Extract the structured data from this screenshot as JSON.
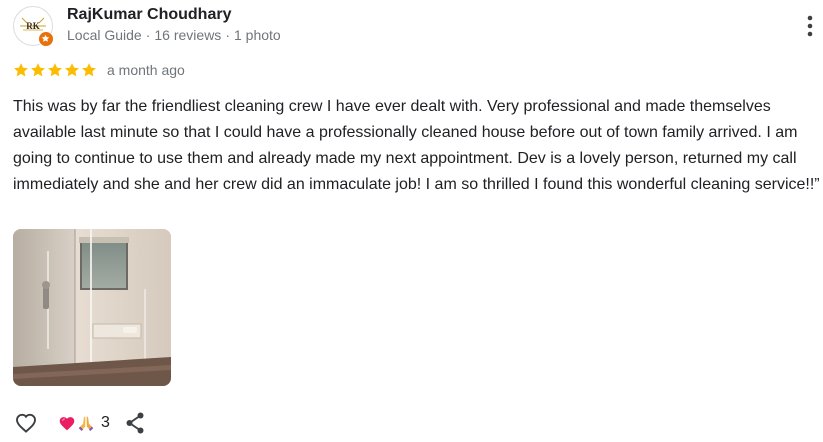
{
  "reviewer": {
    "name": "RajKumar Choudhary",
    "avatar_monogram": "RK",
    "badge_icon": "local-guide-star-icon",
    "level": "Local Guide",
    "meta_separator": "·",
    "reviews": "16 reviews",
    "photos": "1 photo"
  },
  "review": {
    "rating": 5,
    "rating_max": 5,
    "star_color": "#fbbc04",
    "time": "a month ago",
    "text": "This was by far the friendliest cleaning crew I have ever dealt with. Very professional and made themselves available last minute so that I could have a professionally cleaned house before out of town family arrived. I am going to continue to use them and already made my next appointment. Dev is a lovely person, returned my call immediately and she and her crew did an immaculate job! I am so thrilled I found this wonderful cleaning service!!”",
    "photos": [
      {
        "icon": "bathroom-shower-photo"
      }
    ]
  },
  "actions": {
    "like_icon": "heart-outline-icon",
    "reaction_icons": [
      "heart-reaction-icon",
      "praying-hands-reaction-icon"
    ],
    "reaction_count": "3",
    "share_icon": "share-icon",
    "more_icon": "more-vert-icon"
  },
  "colors": {
    "name": "#202124",
    "secondary_text": "#70757a",
    "badge": "#e8710a",
    "icon": "#3c4043"
  }
}
